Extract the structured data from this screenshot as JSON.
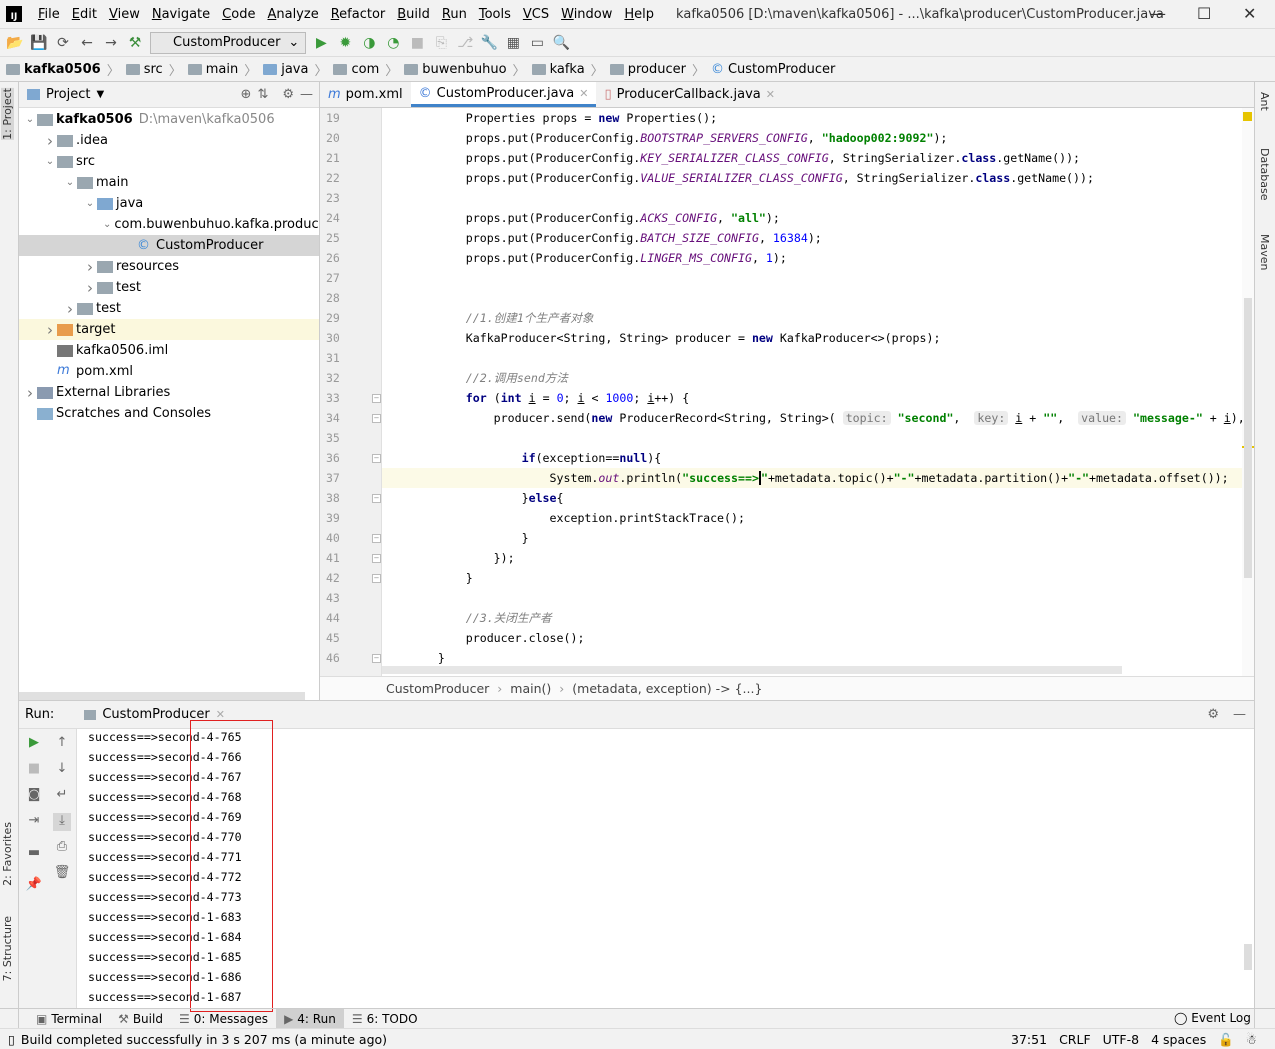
{
  "window": {
    "title": "kafka0506 [D:\\maven\\kafka0506] - ...\\kafka\\producer\\CustomProducer.java",
    "logo": "IJ"
  },
  "menu": [
    "File",
    "Edit",
    "View",
    "Navigate",
    "Code",
    "Analyze",
    "Refactor",
    "Build",
    "Run",
    "Tools",
    "VCS",
    "Window",
    "Help"
  ],
  "toolbar": {
    "run_config": "CustomProducer"
  },
  "breadcrumbs": [
    "kafka0506",
    "src",
    "main",
    "java",
    "com",
    "buwenbuhuo",
    "kafka",
    "producer",
    "CustomProducer"
  ],
  "left_strip": {
    "project": "1: Project",
    "favorites": "2: Favorites",
    "structure": "7: Structure"
  },
  "right_strip": [
    "Ant",
    "Database",
    "Maven"
  ],
  "project_panel": {
    "title": "Project",
    "tree": [
      {
        "label": "kafka0506",
        "extra": "D:\\maven\\kafka0506",
        "depth": 0,
        "chev": "v",
        "icon": "folder",
        "bold": true
      },
      {
        "label": ".idea",
        "depth": 1,
        "chev": ">",
        "icon": "folder"
      },
      {
        "label": "src",
        "depth": 1,
        "chev": "v",
        "icon": "folder"
      },
      {
        "label": "main",
        "depth": 2,
        "chev": "v",
        "icon": "folder"
      },
      {
        "label": "java",
        "depth": 3,
        "chev": "v",
        "icon": "folder-blue"
      },
      {
        "label": "com.buwenbuhuo.kafka.producer",
        "depth": 4,
        "chev": "v",
        "icon": "package"
      },
      {
        "label": "CustomProducer",
        "depth": 5,
        "chev": "",
        "icon": "class",
        "state": "selected"
      },
      {
        "label": "resources",
        "depth": 3,
        "chev": ">",
        "icon": "folder"
      },
      {
        "label": "test",
        "depth": 3,
        "chev": ">",
        "icon": "folder"
      },
      {
        "label": "test",
        "depth": 2,
        "chev": ">",
        "icon": "folder"
      },
      {
        "label": "target",
        "depth": 1,
        "chev": ">",
        "icon": "folder-orange",
        "state": "highlight"
      },
      {
        "label": "kafka0506.iml",
        "depth": 1,
        "chev": "",
        "icon": "file"
      },
      {
        "label": "pom.xml",
        "depth": 1,
        "chev": "",
        "icon": "maven"
      },
      {
        "label": "External Libraries",
        "depth": 0,
        "chev": ">",
        "icon": "library"
      },
      {
        "label": "Scratches and Consoles",
        "depth": 0,
        "chev": "",
        "icon": "scratch"
      }
    ]
  },
  "editor": {
    "tabs": [
      {
        "label": "pom.xml",
        "icon": "m",
        "active": false
      },
      {
        "label": "CustomProducer.java",
        "icon": "c",
        "active": true
      },
      {
        "label": "ProducerCallback.java",
        "icon": "j",
        "active": false
      }
    ],
    "current_line": 37,
    "lines": [
      {
        "n": 19,
        "t": [
          [
            "        Properties props = ",
            ""
          ],
          [
            "new",
            "kw"
          ],
          [
            " Properties();",
            ""
          ]
        ]
      },
      {
        "n": 20,
        "t": [
          [
            "        props.put(ProducerConfig.",
            ""
          ],
          [
            "BOOTSTRAP_SERVERS_CONFIG",
            "fld"
          ],
          [
            ", ",
            ""
          ],
          [
            "\"hadoop002:9092\"",
            "str"
          ],
          [
            ");",
            ""
          ]
        ]
      },
      {
        "n": 21,
        "t": [
          [
            "        props.put(ProducerConfig.",
            ""
          ],
          [
            "KEY_SERIALIZER_CLASS_CONFIG",
            "fld"
          ],
          [
            ", StringSerializer.",
            ""
          ],
          [
            "class",
            "kw"
          ],
          [
            ".getName());",
            ""
          ]
        ]
      },
      {
        "n": 22,
        "t": [
          [
            "        props.put(ProducerConfig.",
            ""
          ],
          [
            "VALUE_SERIALIZER_CLASS_CONFIG",
            "fld"
          ],
          [
            ", StringSerializer.",
            ""
          ],
          [
            "class",
            "kw"
          ],
          [
            ".getName());",
            ""
          ]
        ]
      },
      {
        "n": 23,
        "t": []
      },
      {
        "n": 24,
        "t": [
          [
            "        props.put(ProducerConfig.",
            ""
          ],
          [
            "ACKS_CONFIG",
            "fld"
          ],
          [
            ", ",
            ""
          ],
          [
            "\"all\"",
            "str"
          ],
          [
            ");",
            ""
          ]
        ]
      },
      {
        "n": 25,
        "t": [
          [
            "        props.put(ProducerConfig.",
            ""
          ],
          [
            "BATCH_SIZE_CONFIG",
            "fld"
          ],
          [
            ", ",
            ""
          ],
          [
            "16384",
            "num"
          ],
          [
            ");",
            ""
          ]
        ]
      },
      {
        "n": 26,
        "t": [
          [
            "        props.put(ProducerConfig.",
            ""
          ],
          [
            "LINGER_MS_CONFIG",
            "fld"
          ],
          [
            ", ",
            ""
          ],
          [
            "1",
            "num"
          ],
          [
            ");",
            ""
          ]
        ]
      },
      {
        "n": 27,
        "t": []
      },
      {
        "n": 28,
        "t": []
      },
      {
        "n": 29,
        "t": [
          [
            "        ",
            ""
          ],
          [
            "//1.创建1个生产者对象",
            "cmt"
          ]
        ]
      },
      {
        "n": 30,
        "t": [
          [
            "        KafkaProducer<String, String> producer = ",
            ""
          ],
          [
            "new",
            "kw"
          ],
          [
            " KafkaProducer<>(props);",
            ""
          ]
        ]
      },
      {
        "n": 31,
        "t": []
      },
      {
        "n": 32,
        "t": [
          [
            "        ",
            ""
          ],
          [
            "//2.调用send方法",
            "cmt"
          ]
        ]
      },
      {
        "n": 33,
        "t": [
          [
            "        ",
            ""
          ],
          [
            "for",
            "kw"
          ],
          [
            " (",
            ""
          ],
          [
            "int",
            "kw"
          ],
          [
            " ",
            ""
          ],
          [
            "i",
            "und"
          ],
          [
            " = ",
            ""
          ],
          [
            "0",
            "num"
          ],
          [
            "; ",
            ""
          ],
          [
            "i",
            "und"
          ],
          [
            " < ",
            ""
          ],
          [
            "1000",
            "num"
          ],
          [
            "; ",
            ""
          ],
          [
            "i",
            "und"
          ],
          [
            "++) {",
            ""
          ]
        ]
      },
      {
        "n": 34,
        "t": [
          [
            "            producer.send(",
            ""
          ],
          [
            "new",
            "kw"
          ],
          [
            " ProducerRecord<String, String>( ",
            ""
          ],
          [
            "topic:",
            "hint"
          ],
          [
            " ",
            ""
          ],
          [
            "\"second\"",
            "str"
          ],
          [
            ",  ",
            ""
          ],
          [
            "key:",
            "hint"
          ],
          [
            " ",
            ""
          ],
          [
            "i",
            "und"
          ],
          [
            " + ",
            ""
          ],
          [
            "\"\"",
            "str"
          ],
          [
            ",  ",
            ""
          ],
          [
            "value:",
            "hint"
          ],
          [
            " ",
            ""
          ],
          [
            "\"message-\"",
            "str"
          ],
          [
            " + ",
            ""
          ],
          [
            "i",
            "und"
          ],
          [
            "), (metadata, exception) -> {",
            ""
          ]
        ]
      },
      {
        "n": 35,
        "t": []
      },
      {
        "n": 36,
        "t": [
          [
            "                ",
            ""
          ],
          [
            "if",
            "kw"
          ],
          [
            "(exception==",
            ""
          ],
          [
            "null",
            "kw"
          ],
          [
            "){",
            ""
          ]
        ]
      },
      {
        "n": 37,
        "t": [
          [
            "                    System.",
            ""
          ],
          [
            "out",
            "fld"
          ],
          [
            ".println(",
            ""
          ],
          [
            "\"success==>",
            "str"
          ],
          [
            "\"",
            "str caret"
          ],
          [
            "+metadata.topic()+",
            ""
          ],
          [
            "\"-\"",
            "str"
          ],
          [
            "+metadata.partition()+",
            ""
          ],
          [
            "\"-\"",
            "str"
          ],
          [
            "+metadata.offset());",
            ""
          ]
        ]
      },
      {
        "n": 38,
        "t": [
          [
            "                }",
            ""
          ],
          [
            "else",
            "kw"
          ],
          [
            "{",
            ""
          ]
        ]
      },
      {
        "n": 39,
        "t": [
          [
            "                    exception.printStackTrace();",
            ""
          ]
        ]
      },
      {
        "n": 40,
        "t": [
          [
            "                }",
            ""
          ]
        ]
      },
      {
        "n": 41,
        "t": [
          [
            "            });",
            ""
          ]
        ]
      },
      {
        "n": 42,
        "t": [
          [
            "        }",
            ""
          ]
        ]
      },
      {
        "n": 43,
        "t": []
      },
      {
        "n": 44,
        "t": [
          [
            "        ",
            ""
          ],
          [
            "//3.关闭生产者",
            "cmt"
          ]
        ]
      },
      {
        "n": 45,
        "t": [
          [
            "        producer.close();",
            ""
          ]
        ]
      },
      {
        "n": 46,
        "t": [
          [
            "    }",
            ""
          ]
        ]
      }
    ],
    "breadcrumb": [
      "CustomProducer",
      "main()",
      "(metadata, exception) -> {...}"
    ]
  },
  "run_panel": {
    "label": "Run:",
    "tab": "CustomProducer",
    "output": [
      "success==>second-4-765",
      "success==>second-4-766",
      "success==>second-4-767",
      "success==>second-4-768",
      "success==>second-4-769",
      "success==>second-4-770",
      "success==>second-4-771",
      "success==>second-4-772",
      "success==>second-4-773",
      "success==>second-1-683",
      "success==>second-1-684",
      "success==>second-1-685",
      "success==>second-1-686",
      "success==>second-1-687"
    ]
  },
  "bottom_tabs": [
    {
      "label": "Terminal",
      "icon": "terminal"
    },
    {
      "label": "Build",
      "icon": "hammer"
    },
    {
      "label": "0: Messages",
      "icon": "list"
    },
    {
      "label": "4: Run",
      "icon": "play",
      "active": true
    },
    {
      "label": "6: TODO",
      "icon": "list"
    }
  ],
  "event_log": "Event Log",
  "status": {
    "message": "Build completed successfully in 3 s 207 ms (a minute ago)",
    "position": "37:51",
    "line_sep": "CRLF",
    "encoding": "UTF-8",
    "indent": "4 spaces"
  },
  "colors": {
    "accent": "#4083c9",
    "keyword": "#000080",
    "string": "#008000",
    "field": "#660e7a",
    "annotation_box": "#e02020"
  }
}
